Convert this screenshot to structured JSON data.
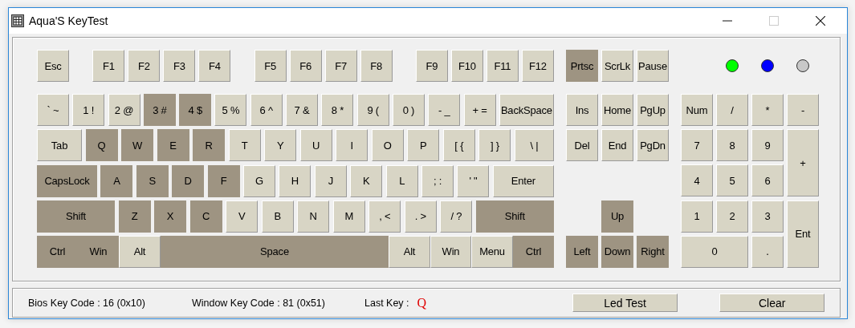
{
  "window": {
    "title": "Aqua'S KeyTest"
  },
  "function_keys": [
    [
      {
        "label": "Esc",
        "pressed": false
      }
    ],
    [
      {
        "label": "F1",
        "pressed": false
      },
      {
        "label": "F2",
        "pressed": false
      },
      {
        "label": "F3",
        "pressed": false
      },
      {
        "label": "F4",
        "pressed": false
      }
    ],
    [
      {
        "label": "F5",
        "pressed": false
      },
      {
        "label": "F6",
        "pressed": false
      },
      {
        "label": "F7",
        "pressed": false
      },
      {
        "label": "F8",
        "pressed": false
      }
    ],
    [
      {
        "label": "F9",
        "pressed": false
      },
      {
        "label": "F10",
        "pressed": false
      },
      {
        "label": "F11",
        "pressed": false
      },
      {
        "label": "F12",
        "pressed": false
      }
    ]
  ],
  "system_keys": [
    {
      "label": "Prtsc",
      "pressed": true
    },
    {
      "label": "ScrLk",
      "pressed": false
    },
    {
      "label": "Pause",
      "pressed": false
    }
  ],
  "leds": [
    {
      "color": "#00ff00"
    },
    {
      "color": "#0000ff"
    },
    {
      "color": "#c8c8c8"
    }
  ],
  "main_rows": [
    [
      {
        "label": "` ~",
        "kind": "char",
        "pressed": false
      },
      {
        "label": "1 !",
        "kind": "char",
        "pressed": false
      },
      {
        "label": "2 @",
        "kind": "char",
        "pressed": false
      },
      {
        "label": "3 #",
        "kind": "char",
        "pressed": true
      },
      {
        "label": "4 $",
        "kind": "char",
        "pressed": true
      },
      {
        "label": "5 %",
        "kind": "char",
        "pressed": false
      },
      {
        "label": "6 ^",
        "kind": "char",
        "pressed": false
      },
      {
        "label": "7 &",
        "kind": "char",
        "pressed": false
      },
      {
        "label": "8 *",
        "kind": "char",
        "pressed": false
      },
      {
        "label": "9 (",
        "kind": "char",
        "pressed": false
      },
      {
        "label": "0 )",
        "kind": "char",
        "pressed": false
      },
      {
        "label": "- _",
        "kind": "char",
        "pressed": false
      },
      {
        "label": "+ =",
        "kind": "char",
        "pressed": false
      },
      {
        "label": "BackSpace",
        "kind": "backspace",
        "pressed": false
      }
    ],
    [
      {
        "label": "Tab",
        "kind": "tab",
        "pressed": false
      },
      {
        "label": "Q",
        "kind": "char",
        "pressed": true
      },
      {
        "label": "W",
        "kind": "char",
        "pressed": true
      },
      {
        "label": "E",
        "kind": "char",
        "pressed": true
      },
      {
        "label": "R",
        "kind": "char",
        "pressed": true
      },
      {
        "label": "T",
        "kind": "char",
        "pressed": false
      },
      {
        "label": "Y",
        "kind": "char",
        "pressed": false
      },
      {
        "label": "U",
        "kind": "char",
        "pressed": false
      },
      {
        "label": "I",
        "kind": "char",
        "pressed": false
      },
      {
        "label": "O",
        "kind": "char",
        "pressed": false
      },
      {
        "label": "P",
        "kind": "char",
        "pressed": false
      },
      {
        "label": "[ {",
        "kind": "char",
        "pressed": false
      },
      {
        "label": "] }",
        "kind": "char",
        "pressed": false
      },
      {
        "label": "\\ |",
        "kind": "backslash",
        "pressed": false
      }
    ],
    [
      {
        "label": "CapsLock",
        "kind": "caps",
        "pressed": true
      },
      {
        "label": "A",
        "kind": "char",
        "pressed": true
      },
      {
        "label": "S",
        "kind": "char",
        "pressed": true
      },
      {
        "label": "D",
        "kind": "char",
        "pressed": true
      },
      {
        "label": "F",
        "kind": "char",
        "pressed": true
      },
      {
        "label": "G",
        "kind": "char",
        "pressed": false
      },
      {
        "label": "H",
        "kind": "char",
        "pressed": false
      },
      {
        "label": "J",
        "kind": "char",
        "pressed": false
      },
      {
        "label": "K",
        "kind": "char",
        "pressed": false
      },
      {
        "label": "L",
        "kind": "char",
        "pressed": false
      },
      {
        "label": "; :",
        "kind": "char",
        "pressed": false
      },
      {
        "label": "' \"",
        "kind": "char",
        "pressed": false
      },
      {
        "label": "Enter",
        "kind": "enter",
        "pressed": false
      }
    ],
    [
      {
        "label": "Shift",
        "kind": "shift",
        "pressed": true
      },
      {
        "label": "Z",
        "kind": "char",
        "pressed": true
      },
      {
        "label": "X",
        "kind": "char",
        "pressed": true
      },
      {
        "label": "C",
        "kind": "char",
        "pressed": true
      },
      {
        "label": "V",
        "kind": "char",
        "pressed": false
      },
      {
        "label": "B",
        "kind": "char",
        "pressed": false
      },
      {
        "label": "N",
        "kind": "char",
        "pressed": false
      },
      {
        "label": "M",
        "kind": "char",
        "pressed": false
      },
      {
        "label": ", <",
        "kind": "char",
        "pressed": false
      },
      {
        "label": ". >",
        "kind": "char",
        "pressed": false
      },
      {
        "label": "/ ?",
        "kind": "char",
        "pressed": false
      },
      {
        "label": "Shift",
        "kind": "shift",
        "pressed": true
      }
    ],
    [
      {
        "label": "Ctrl",
        "kind": "ctrl",
        "pressed": true
      },
      {
        "label": "Win",
        "kind": "win",
        "pressed": true
      },
      {
        "label": "Alt",
        "kind": "alt",
        "pressed": false
      },
      {
        "label": "Space",
        "kind": "space",
        "pressed": true
      },
      {
        "label": "Alt",
        "kind": "alt",
        "pressed": false
      },
      {
        "label": "Win",
        "kind": "win",
        "pressed": false
      },
      {
        "label": "Menu",
        "kind": "menu",
        "pressed": false
      },
      {
        "label": "Ctrl",
        "kind": "ctrl",
        "pressed": true
      }
    ]
  ],
  "nav_keys": [
    {
      "label": "Ins",
      "pressed": false
    },
    {
      "label": "Home",
      "pressed": false
    },
    {
      "label": "PgUp",
      "pressed": false
    },
    {
      "label": "Del",
      "pressed": false
    },
    {
      "label": "End",
      "pressed": false
    },
    {
      "label": "PgDn",
      "pressed": false
    },
    {
      "label": "Up",
      "pressed": true
    },
    {
      "label": "Left",
      "pressed": true
    },
    {
      "label": "Down",
      "pressed": true
    },
    {
      "label": "Right",
      "pressed": true
    }
  ],
  "numpad_keys": [
    {
      "label": "Num",
      "kind": "key",
      "pressed": false
    },
    {
      "label": "/",
      "kind": "key",
      "pressed": false
    },
    {
      "label": "*",
      "kind": "key",
      "pressed": false
    },
    {
      "label": "-",
      "kind": "key",
      "pressed": false
    },
    {
      "label": "7",
      "kind": "key",
      "pressed": false
    },
    {
      "label": "8",
      "kind": "key",
      "pressed": false
    },
    {
      "label": "9",
      "kind": "key",
      "pressed": false
    },
    {
      "label": "+",
      "kind": "tall",
      "pressed": false
    },
    {
      "label": "4",
      "kind": "key",
      "pressed": false
    },
    {
      "label": "5",
      "kind": "key",
      "pressed": false
    },
    {
      "label": "6",
      "kind": "key",
      "pressed": false
    },
    {
      "label": "1",
      "kind": "key",
      "pressed": false
    },
    {
      "label": "2",
      "kind": "key",
      "pressed": false
    },
    {
      "label": "3",
      "kind": "key",
      "pressed": false
    },
    {
      "label": "Ent",
      "kind": "tall",
      "pressed": false
    },
    {
      "label": "0",
      "kind": "wide",
      "pressed": false
    },
    {
      "label": ".",
      "kind": "key",
      "pressed": false
    }
  ],
  "status": {
    "bios_code": "Bios Key Code : 16 (0x10)",
    "window_code": "Window Key Code : 81 (0x51)",
    "last_key_label": "Last Key :",
    "last_key": "Q"
  },
  "buttons": [
    "Led Test",
    "Clear"
  ]
}
